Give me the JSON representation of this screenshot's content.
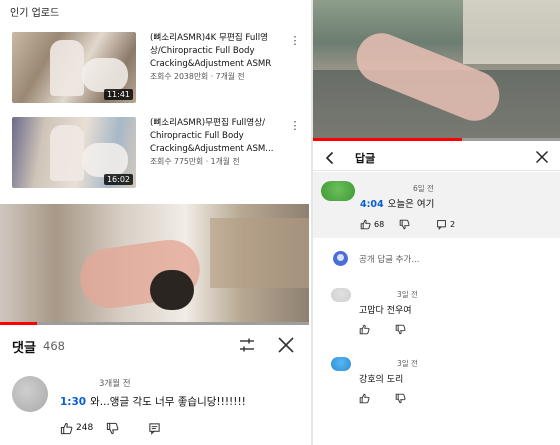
{
  "popular_uploads": {
    "title": "인기 업로드",
    "videos": [
      {
        "title": "(뼈소리ASMR)4K 무편집 Full영상/Chiropractic Full Body Cracking&Adjustment ASMR",
        "meta": "조회수 2038만회 · 7개월 전",
        "duration": "11:41"
      },
      {
        "title": "(뼈소리ASMR)무편집 Full영상/ Chiropractic Full Body Cracking&Adjustment ASM...",
        "meta": "조회수 775만회 · 1개월 전",
        "duration": "16:02"
      }
    ]
  },
  "left_player": {
    "progress": 0.12
  },
  "comments": {
    "label": "댓글",
    "count": "468",
    "top_comment": {
      "time": "3개월 전",
      "timestamp": "1:30",
      "text": "와...앵글 각도 너무 좋습니당!!!!!!!",
      "likes": "248"
    }
  },
  "right_player": {
    "progress": 0.6
  },
  "replies_panel": {
    "title": "답글",
    "parent": {
      "time": "6일 전",
      "timestamp": "4:04",
      "text": "오늘은 여기",
      "likes": "68",
      "reply_count": "2"
    },
    "add_reply_placeholder": "공개 답글 추가...",
    "replies": [
      {
        "time": "3일 전",
        "text": "고맙다 전우여"
      },
      {
        "time": "3일 전",
        "text": "강호의 도리"
      }
    ]
  },
  "colors": {
    "accent": "#065fd4",
    "progress": "#ff0000",
    "highlight_bg": "#f2f2f2"
  },
  "icons": [
    "more-vert-icon",
    "sort-icon",
    "close-icon",
    "back-arrow-icon",
    "like-icon",
    "dislike-icon",
    "reply-icon"
  ]
}
